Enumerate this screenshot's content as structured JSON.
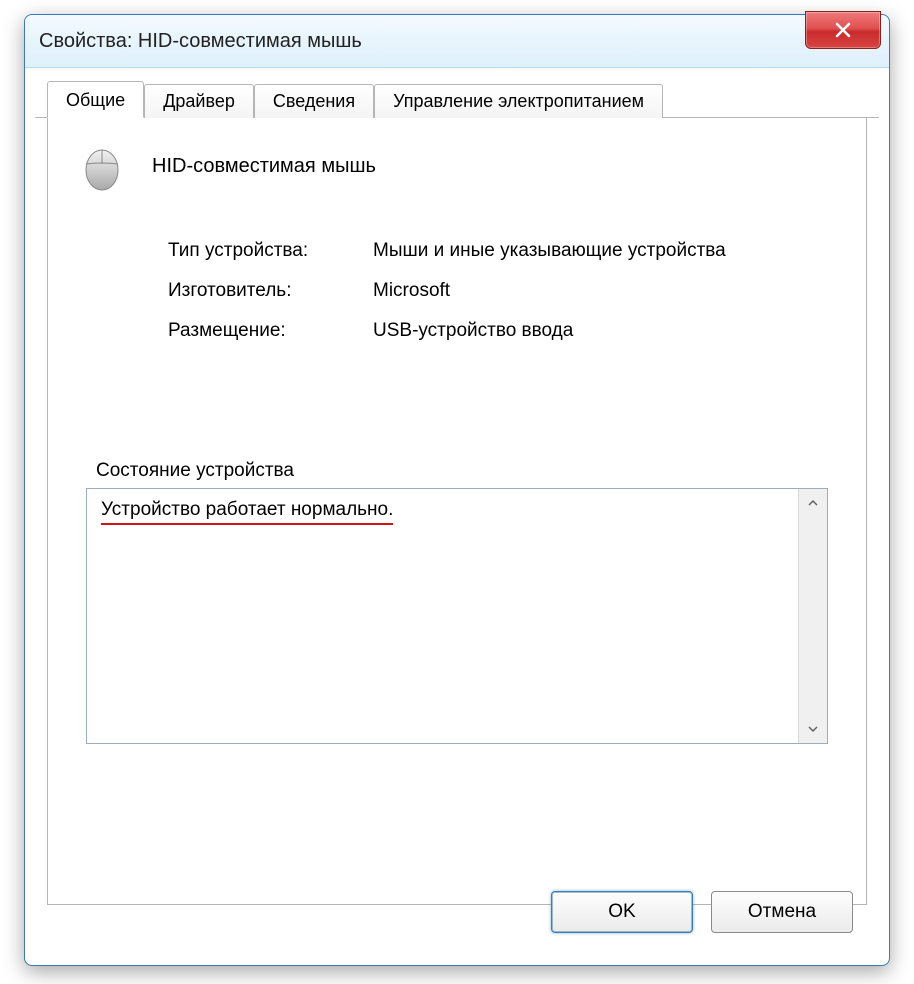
{
  "window": {
    "title": "Свойства: HID-совместимая мышь"
  },
  "tabs": {
    "general": "Общие",
    "driver": "Драйвер",
    "details": "Сведения",
    "power": "Управление электропитанием"
  },
  "device": {
    "name": "HID-совместимая мышь"
  },
  "props": {
    "type_label": "Тип устройства:",
    "type_value": "Мыши и иные указывающие устройства",
    "manufacturer_label": "Изготовитель:",
    "manufacturer_value": "Microsoft",
    "location_label": "Размещение:",
    "location_value": "USB-устройство ввода"
  },
  "status": {
    "group_label": "Состояние устройства",
    "text": "Устройство работает нормально."
  },
  "buttons": {
    "ok": "OK",
    "cancel": "Отмена"
  }
}
